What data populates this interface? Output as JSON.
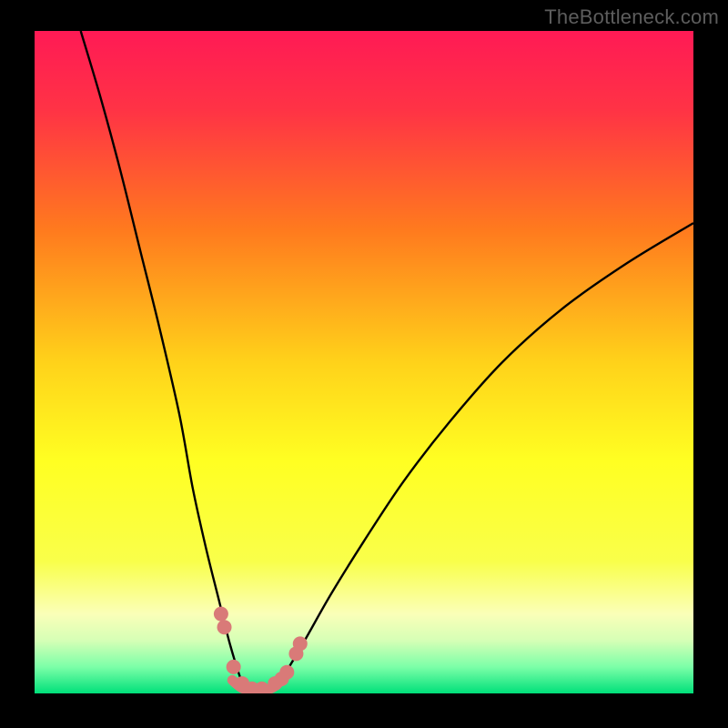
{
  "watermark": "TheBottleneck.com",
  "chart_data": {
    "type": "line",
    "title": "",
    "xlabel": "",
    "ylabel": "",
    "xlim": [
      0,
      100
    ],
    "ylim": [
      0,
      100
    ],
    "grid": false,
    "legend": false,
    "gradient_stops": [
      {
        "offset": 0.0,
        "color": "#ff1a55"
      },
      {
        "offset": 0.12,
        "color": "#ff3345"
      },
      {
        "offset": 0.3,
        "color": "#ff7a1e"
      },
      {
        "offset": 0.5,
        "color": "#ffd21a"
      },
      {
        "offset": 0.65,
        "color": "#ffff22"
      },
      {
        "offset": 0.8,
        "color": "#f9ff4a"
      },
      {
        "offset": 0.88,
        "color": "#faffb8"
      },
      {
        "offset": 0.92,
        "color": "#d6ffb6"
      },
      {
        "offset": 0.96,
        "color": "#7cffa8"
      },
      {
        "offset": 1.0,
        "color": "#00e07a"
      }
    ],
    "series": [
      {
        "name": "left-branch",
        "x": [
          7,
          10,
          13,
          16,
          19,
          22,
          24,
          26,
          28,
          29.5,
          31,
          32
        ],
        "y": [
          100,
          90,
          79,
          67,
          55,
          42,
          31,
          22,
          14,
          8,
          3,
          0.5
        ]
      },
      {
        "name": "right-branch",
        "x": [
          36,
          38,
          41,
          45,
          50,
          56,
          63,
          71,
          80,
          90,
          100
        ],
        "y": [
          0.5,
          3,
          8,
          15,
          23,
          32,
          41,
          50,
          58,
          65,
          71
        ]
      },
      {
        "name": "valley-floor",
        "x": [
          30,
          31.5,
          33,
          34.5,
          36,
          37.5
        ],
        "y": [
          2,
          0.8,
          0.6,
          0.6,
          0.8,
          2
        ]
      }
    ],
    "markers": [
      {
        "series": "left-branch",
        "points": [
          {
            "x": 28.3,
            "y": 12
          },
          {
            "x": 28.8,
            "y": 10
          },
          {
            "x": 30.2,
            "y": 4
          },
          {
            "x": 31.5,
            "y": 1.5
          }
        ]
      },
      {
        "series": "right-branch",
        "points": [
          {
            "x": 36.5,
            "y": 1.5
          },
          {
            "x": 37.5,
            "y": 2.2
          },
          {
            "x": 38.3,
            "y": 3.2
          },
          {
            "x": 39.7,
            "y": 6
          },
          {
            "x": 40.3,
            "y": 7.5
          }
        ]
      },
      {
        "series": "valley-floor",
        "points": [
          {
            "x": 33,
            "y": 0.7
          },
          {
            "x": 34.5,
            "y": 0.7
          }
        ]
      }
    ],
    "marker_style": {
      "color": "#d97a78",
      "radius_px": 8
    }
  }
}
